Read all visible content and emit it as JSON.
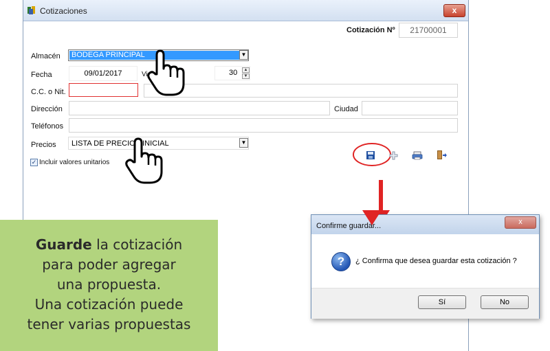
{
  "window": {
    "title": "Cotizaciones",
    "close_label": "x"
  },
  "quote": {
    "label": "Cotización Nº",
    "number": "21700001"
  },
  "form": {
    "almacen": {
      "label": "Almacén",
      "value": "BODEGA PRINCIPAL"
    },
    "fecha": {
      "label": "Fecha",
      "value": "09/01/2017"
    },
    "vigencia": {
      "label": "Vig",
      "value": "30"
    },
    "cc_nit": {
      "label": "C.C. o Nit."
    },
    "direccion": {
      "label": "Dirección"
    },
    "ciudad": {
      "label": "Ciudad"
    },
    "telefonos": {
      "label": "Teléfonos"
    },
    "precios": {
      "label": "Precios",
      "value": "LISTA DE PRECIOS INICIAL"
    },
    "incluir": {
      "label": "Incluir valores unitarios",
      "checked": true
    }
  },
  "toolbar": {
    "icons": [
      "save-icon",
      "add-icon",
      "print-icon",
      "exit-icon"
    ]
  },
  "note": {
    "bold": "Guarde",
    "line1": " la cotización",
    "line2": "para poder agregar",
    "line3": "una propuesta.",
    "line4": "Una cotización puede",
    "line5": "tener varias propuestas"
  },
  "dialog": {
    "title": "Confirme guardar...",
    "close_label": "x",
    "message": "¿ Confirma que desea guardar esta cotización ?",
    "yes_label": "Sí",
    "no_label": "No"
  },
  "colors": {
    "selection": "#3399ff",
    "note_bg": "#b2d47e",
    "arrow": "#e02424",
    "required_border": "#e03030"
  }
}
